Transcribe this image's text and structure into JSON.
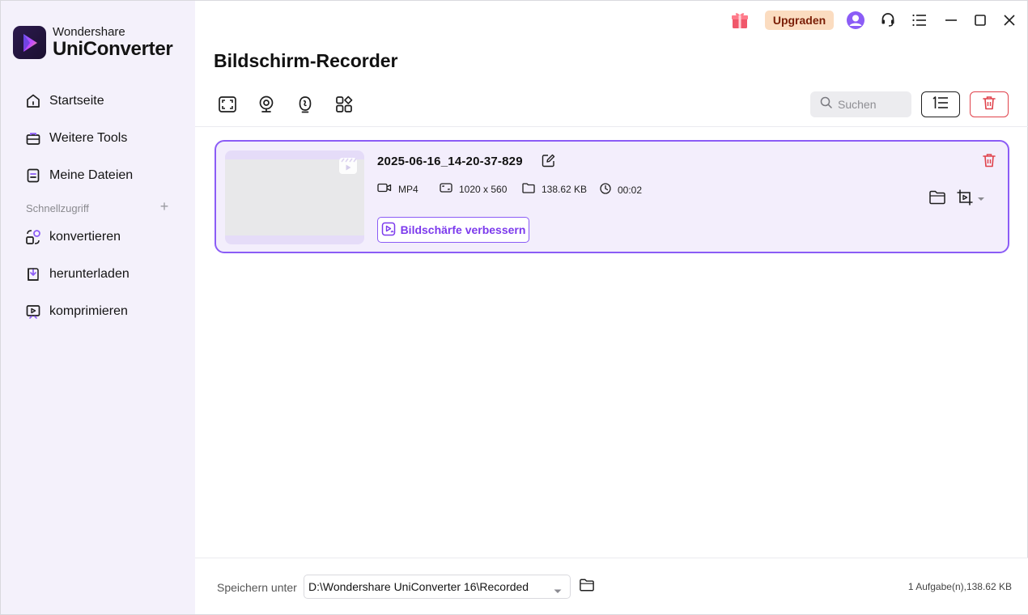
{
  "app": {
    "brand_top": "Wondershare",
    "brand_name": "UniConverter"
  },
  "titlebar": {
    "upgrade_label": "Upgraden",
    "icons": [
      "gift-icon",
      "avatar-icon",
      "headset-icon",
      "menu-icon",
      "minimize-icon",
      "maximize-icon",
      "close-icon"
    ]
  },
  "sidebar": {
    "items": [
      {
        "label": "Startseite",
        "icon": "home-icon"
      },
      {
        "label": "Weitere Tools",
        "icon": "toolbox-icon"
      },
      {
        "label": "Meine Dateien",
        "icon": "files-icon"
      }
    ],
    "quick_access_label": "Schnellzugriff",
    "quick_items": [
      {
        "label": "konvertieren",
        "icon": "convert-icon"
      },
      {
        "label": "herunterladen",
        "icon": "download-icon"
      },
      {
        "label": "komprimieren",
        "icon": "compress-icon"
      }
    ]
  },
  "main": {
    "title": "Bildschirm-Recorder",
    "toolbar_icons": [
      "screen-record-icon",
      "webcam-record-icon",
      "audio-record-icon",
      "more-apps-icon"
    ],
    "search": {
      "placeholder": "Suchen",
      "value": ""
    }
  },
  "recordings": [
    {
      "name": "2025-06-16_14-20-37-829",
      "format": "MP4",
      "resolution": "1020 x 560",
      "size": "138.62 KB",
      "duration": "00:02",
      "enhance_label": "Bildschärfe verbessern"
    }
  ],
  "footer": {
    "save_label": "Speichern unter",
    "path": "D:\\Wondershare UniConverter 16\\Recorded",
    "status": "1 Aufgabe(n),138.62 KB"
  },
  "colors": {
    "accent": "#8b5cf6",
    "danger": "#e0424b",
    "sidebar_bg": "#f4f1fb",
    "upgrade_bg": "#fbdcc0"
  }
}
